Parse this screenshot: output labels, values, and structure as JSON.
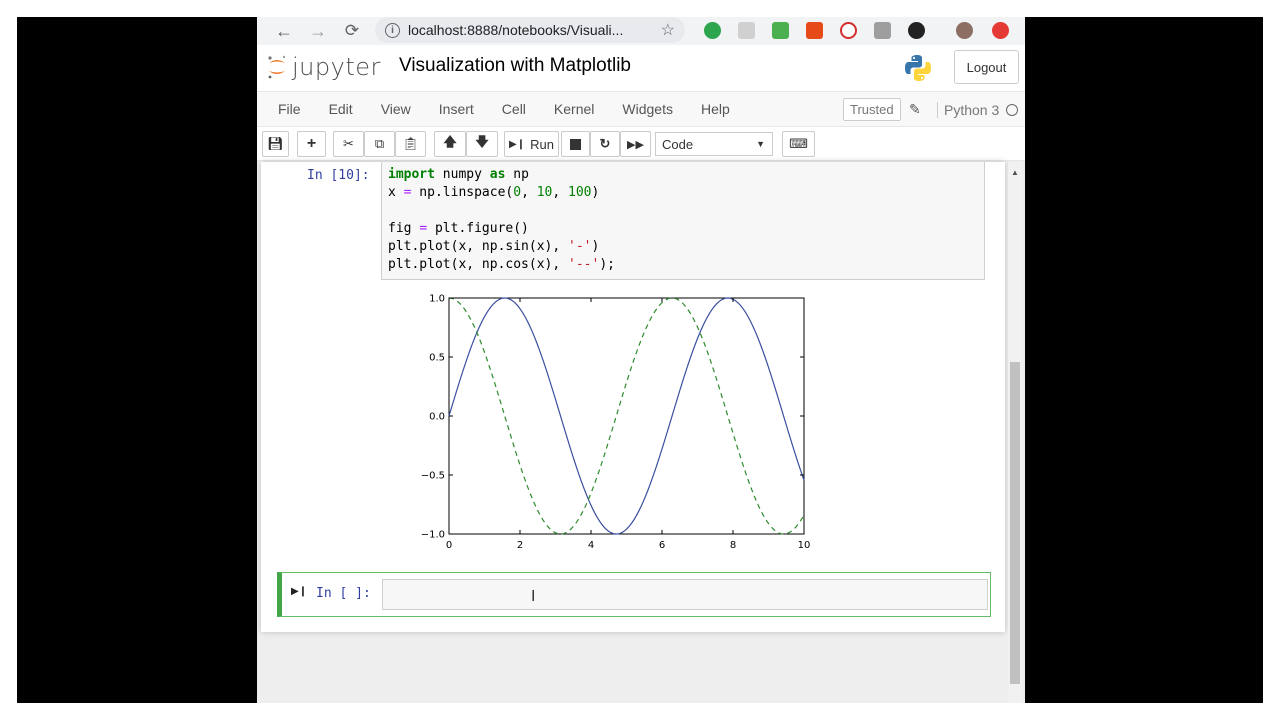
{
  "browser": {
    "url": "localhost:8888/notebooks/Visuali...",
    "back_icon": "arrow-left",
    "forward_icon": "arrow-right",
    "reload_icon": "reload"
  },
  "header": {
    "logo_text": "jupyter",
    "title": "Visualization with Matplotlib",
    "logout_label": "Logout"
  },
  "menubar": {
    "items": [
      "File",
      "Edit",
      "View",
      "Insert",
      "Cell",
      "Kernel",
      "Widgets",
      "Help"
    ],
    "trusted_label": "Trusted",
    "kernel_name": "Python 3"
  },
  "toolbar": {
    "run_label": "Run",
    "cell_type": "Code"
  },
  "cell1": {
    "prompt": "In [10]:",
    "code_lines": [
      "import numpy as np",
      "x = np.linspace(0, 10, 100)",
      "",
      "fig = plt.figure()",
      "plt.plot(x, np.sin(x), '-')",
      "plt.plot(x, np.cos(x), '--');"
    ]
  },
  "cell2": {
    "prompt": "In [ ]:"
  },
  "chart_data": {
    "type": "line",
    "xlim": [
      0,
      10
    ],
    "ylim": [
      -1.0,
      1.0
    ],
    "x_ticks": [
      "0",
      "2",
      "4",
      "6",
      "8",
      "10"
    ],
    "y_ticks": [
      "1.0",
      "0.5",
      "0.0",
      "−0.5",
      "−1.0"
    ],
    "series": [
      {
        "function": "sin",
        "style": "solid",
        "color": "#3a4fa0",
        "x": [
          0,
          0.5,
          1,
          1.5,
          2,
          2.5,
          3,
          3.5,
          4,
          4.5,
          5,
          5.5,
          6,
          6.5,
          7,
          7.5,
          8,
          8.5,
          9,
          9.5,
          10
        ],
        "y": [
          0,
          0.48,
          0.84,
          1.0,
          0.91,
          0.6,
          0.14,
          -0.35,
          -0.76,
          -0.98,
          -0.96,
          -0.71,
          -0.28,
          0.22,
          0.66,
          0.94,
          0.99,
          0.8,
          0.41,
          -0.08,
          -0.54
        ]
      },
      {
        "function": "cos",
        "style": "dashed",
        "color": "#2e8b2e",
        "x": [
          0,
          0.5,
          1,
          1.5,
          2,
          2.5,
          3,
          3.5,
          4,
          4.5,
          5,
          5.5,
          6,
          6.5,
          7,
          7.5,
          8,
          8.5,
          9,
          9.5,
          10
        ],
        "y": [
          1.0,
          0.88,
          0.54,
          0.07,
          -0.42,
          -0.8,
          -0.99,
          -0.94,
          -0.65,
          -0.21,
          0.28,
          0.71,
          0.96,
          0.98,
          0.75,
          0.35,
          -0.15,
          -0.6,
          -0.91,
          -1.0,
          -0.84
        ]
      }
    ]
  }
}
